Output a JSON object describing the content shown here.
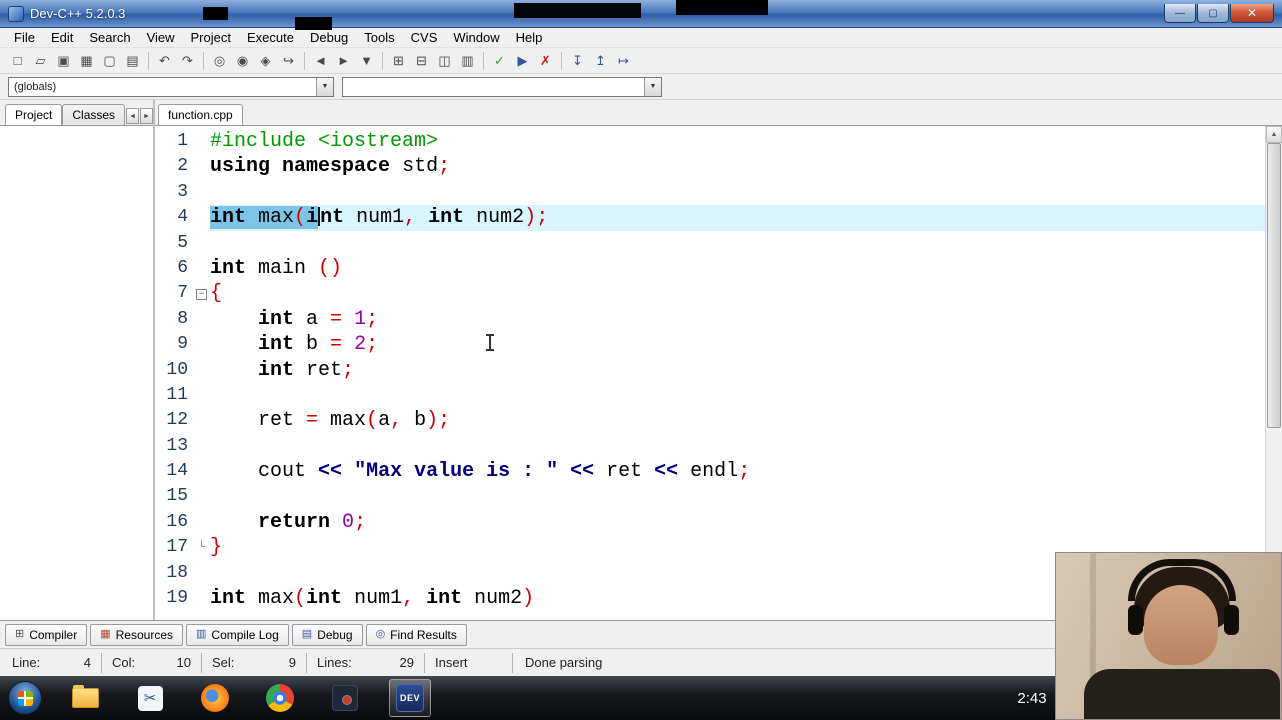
{
  "titlebar": {
    "title": "Dev-C++ 5.2.0.3",
    "controls": {
      "minimize": "—",
      "maximize": "▢",
      "close": "✕"
    }
  },
  "menubar": {
    "items": [
      "File",
      "Edit",
      "Search",
      "View",
      "Project",
      "Execute",
      "Debug",
      "Tools",
      "CVS",
      "Window",
      "Help"
    ]
  },
  "toolbar": {
    "items": [
      {
        "name": "new-source",
        "glyph": "□"
      },
      {
        "name": "open-project",
        "glyph": "▱"
      },
      {
        "name": "save",
        "glyph": "▣"
      },
      {
        "name": "save-all",
        "glyph": "▦"
      },
      {
        "name": "close-file",
        "glyph": "▢"
      },
      {
        "name": "print",
        "glyph": "▤"
      },
      {
        "sep": true
      },
      {
        "name": "undo",
        "glyph": "↶"
      },
      {
        "name": "redo",
        "glyph": "↷"
      },
      {
        "sep": true
      },
      {
        "name": "find",
        "glyph": "◎"
      },
      {
        "name": "find-in-files",
        "glyph": "◉"
      },
      {
        "name": "replace",
        "glyph": "◈"
      },
      {
        "name": "goto-line",
        "glyph": "↪"
      },
      {
        "sep": true
      },
      {
        "name": "back",
        "glyph": "◄"
      },
      {
        "name": "forward",
        "glyph": "►"
      },
      {
        "name": "goto-declaration",
        "glyph": "▼"
      },
      {
        "sep": true
      },
      {
        "name": "new-project",
        "glyph": "⊞"
      },
      {
        "name": "remove-file",
        "glyph": "⊟"
      },
      {
        "name": "project-properties",
        "glyph": "◫"
      },
      {
        "name": "package-manager",
        "glyph": "▥"
      },
      {
        "sep": true
      },
      {
        "name": "compile",
        "glyph": "✓",
        "color": "#2e9e2e"
      },
      {
        "name": "run",
        "glyph": "▶",
        "color": "#33539e"
      },
      {
        "name": "abort-compilation",
        "glyph": "✗",
        "color": "#cc2222"
      },
      {
        "sep": true
      },
      {
        "name": "debug",
        "glyph": "↧",
        "color": "#33539e"
      },
      {
        "name": "profile",
        "glyph": "↥",
        "color": "#33539e"
      },
      {
        "name": "profiling-analysis",
        "glyph": "↦",
        "color": "#33539e"
      }
    ]
  },
  "combos": {
    "globals": "(globals)",
    "members": "",
    "arrow": "▼"
  },
  "sidebar": {
    "tabs": [
      {
        "label": "Project",
        "active": true
      },
      {
        "label": "Classes",
        "active": false
      }
    ],
    "scroll": {
      "left": "◄",
      "right": "►"
    }
  },
  "editor": {
    "tab": "function.cpp",
    "fold_glyphs": {
      "start": "−",
      "end": "└"
    },
    "scrollbar": {
      "up": "▲",
      "down": "▼"
    },
    "lines": [
      {
        "n": "1",
        "segs": [
          {
            "t": "#include <iostream>",
            "c": "pre"
          }
        ]
      },
      {
        "n": "2",
        "segs": [
          {
            "t": "using",
            "c": "kw"
          },
          {
            "t": " ",
            "c": ""
          },
          {
            "t": "namespace",
            "c": "kw"
          },
          {
            "t": " std",
            "c": ""
          },
          {
            "t": ";",
            "c": "sym"
          }
        ]
      },
      {
        "n": "3",
        "segs": []
      },
      {
        "n": "4",
        "cur": true,
        "segs": [
          {
            "t": "int",
            "c": "kw sel"
          },
          {
            "t": " ",
            "c": "sel"
          },
          {
            "t": "max",
            "c": "sel"
          },
          {
            "t": "(",
            "c": "sym sel"
          },
          {
            "t": "i",
            "c": "kw sel"
          },
          {
            "t": "",
            "c": "caret"
          },
          {
            "t": "nt",
            "c": "kw"
          },
          {
            "t": " num1",
            "c": ""
          },
          {
            "t": ",",
            "c": "sym"
          },
          {
            "t": " ",
            "c": ""
          },
          {
            "t": "int",
            "c": "kw"
          },
          {
            "t": " num2",
            "c": ""
          },
          {
            "t": ")",
            "c": "sym"
          },
          {
            "t": ";",
            "c": "sym"
          }
        ]
      },
      {
        "n": "5",
        "segs": []
      },
      {
        "n": "6",
        "segs": [
          {
            "t": "int",
            "c": "kw"
          },
          {
            "t": " main ",
            "c": ""
          },
          {
            "t": "()",
            "c": "sym"
          }
        ]
      },
      {
        "n": "7",
        "fold": "start",
        "segs": [
          {
            "t": "{",
            "c": "sym"
          }
        ]
      },
      {
        "n": "8",
        "segs": [
          {
            "t": "    ",
            "c": ""
          },
          {
            "t": "int",
            "c": "kw"
          },
          {
            "t": " a ",
            "c": ""
          },
          {
            "t": "=",
            "c": "sym"
          },
          {
            "t": " ",
            "c": ""
          },
          {
            "t": "1",
            "c": "num"
          },
          {
            "t": ";",
            "c": "sym"
          }
        ]
      },
      {
        "n": "9",
        "segs": [
          {
            "t": "    ",
            "c": ""
          },
          {
            "t": "int",
            "c": "kw"
          },
          {
            "t": " b ",
            "c": ""
          },
          {
            "t": "=",
            "c": "sym"
          },
          {
            "t": " ",
            "c": ""
          },
          {
            "t": "2",
            "c": "num"
          },
          {
            "t": ";",
            "c": "sym"
          }
        ]
      },
      {
        "n": "10",
        "segs": [
          {
            "t": "    ",
            "c": ""
          },
          {
            "t": "int",
            "c": "kw"
          },
          {
            "t": " ret",
            "c": ""
          },
          {
            "t": ";",
            "c": "sym"
          }
        ]
      },
      {
        "n": "11",
        "segs": []
      },
      {
        "n": "12",
        "segs": [
          {
            "t": "    ret ",
            "c": ""
          },
          {
            "t": "=",
            "c": "sym"
          },
          {
            "t": " max",
            "c": ""
          },
          {
            "t": "(",
            "c": "sym"
          },
          {
            "t": "a",
            "c": ""
          },
          {
            "t": ",",
            "c": "sym"
          },
          {
            "t": " b",
            "c": ""
          },
          {
            "t": ")",
            "c": "sym"
          },
          {
            "t": ";",
            "c": "sym"
          }
        ]
      },
      {
        "n": "13",
        "segs": []
      },
      {
        "n": "14",
        "segs": [
          {
            "t": "    cout ",
            "c": ""
          },
          {
            "t": "<<",
            "c": "op"
          },
          {
            "t": " ",
            "c": ""
          },
          {
            "t": "\"Max value is : \"",
            "c": "str"
          },
          {
            "t": " ",
            "c": ""
          },
          {
            "t": "<<",
            "c": "op"
          },
          {
            "t": " ret ",
            "c": ""
          },
          {
            "t": "<<",
            "c": "op"
          },
          {
            "t": " endl",
            "c": ""
          },
          {
            "t": ";",
            "c": "sym"
          }
        ]
      },
      {
        "n": "15",
        "segs": []
      },
      {
        "n": "16",
        "segs": [
          {
            "t": "    ",
            "c": ""
          },
          {
            "t": "return",
            "c": "kw"
          },
          {
            "t": " ",
            "c": ""
          },
          {
            "t": "0",
            "c": "num"
          },
          {
            "t": ";",
            "c": "sym"
          }
        ]
      },
      {
        "n": "17",
        "fold": "end",
        "segs": [
          {
            "t": "}",
            "c": "sym"
          }
        ]
      },
      {
        "n": "18",
        "segs": []
      },
      {
        "n": "19",
        "segs": [
          {
            "t": "int",
            "c": "kw"
          },
          {
            "t": " max",
            "c": ""
          },
          {
            "t": "(",
            "c": "sym"
          },
          {
            "t": "int",
            "c": "kw"
          },
          {
            "t": " num1",
            "c": ""
          },
          {
            "t": ",",
            "c": "sym"
          },
          {
            "t": " ",
            "c": ""
          },
          {
            "t": "int",
            "c": "kw"
          },
          {
            "t": " num2",
            "c": ""
          },
          {
            "t": ")",
            "c": "sym"
          }
        ]
      }
    ]
  },
  "bottom_tabs": [
    {
      "label": "Compiler",
      "icon": "compiler-grid",
      "glyph": "⊞",
      "color": "#555555"
    },
    {
      "label": "Resources",
      "icon": "resources",
      "glyph": "▦",
      "color": "#b04030"
    },
    {
      "label": "Compile Log",
      "icon": "compile-log",
      "glyph": "▥",
      "color": "#355a9e"
    },
    {
      "label": "Debug",
      "icon": "debug-rows",
      "glyph": "▤",
      "color": "#355a9e"
    },
    {
      "label": "Find Results",
      "icon": "find-results",
      "glyph": "◎",
      "color": "#355a9e"
    }
  ],
  "statusbar": {
    "items": [
      {
        "label": "Line:",
        "value": "4"
      },
      {
        "label": "Col:",
        "value": "10"
      },
      {
        "label": "Sel:",
        "value": "9"
      },
      {
        "label": "Lines:",
        "value": "29"
      },
      {
        "label": "",
        "value": "Insert"
      },
      {
        "label": "",
        "value": "Done parsing"
      }
    ]
  },
  "taskbar": {
    "clock": "2:43",
    "icons": [
      {
        "name": "explorer"
      },
      {
        "name": "snip"
      },
      {
        "name": "firefox"
      },
      {
        "name": "chrome"
      },
      {
        "name": "recorder"
      },
      {
        "name": "devcpp",
        "label": "DEV",
        "active": true
      }
    ]
  }
}
